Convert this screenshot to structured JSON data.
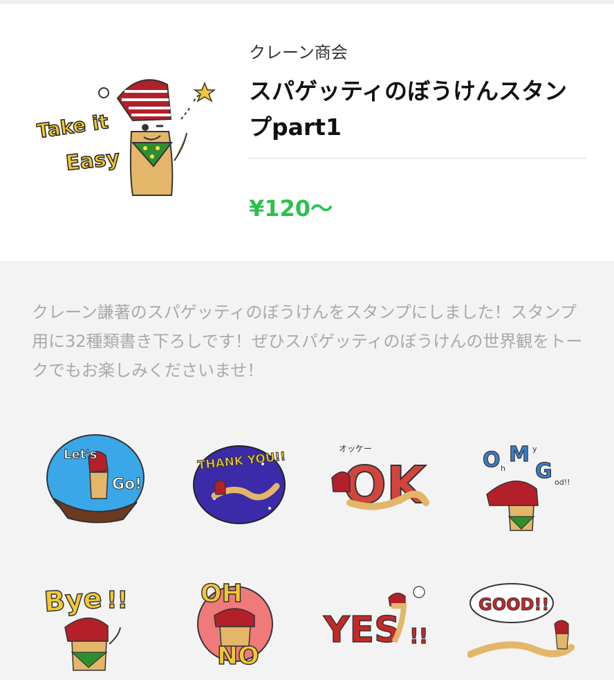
{
  "header": {
    "author": "クレーン商会",
    "title": "スパゲッティのぼうけんスタンプpart1",
    "price": "¥120～",
    "main_sticker": {
      "lettering": [
        "Take it",
        "Easy"
      ]
    }
  },
  "description": "クレーン謙著のスパゲッティのぼうけんをスタンプにしました！スタンプ用に32種類書き下ろしです！ぜひスパゲッティのぼうけんの世界観をトークでもお楽しみくださいませ！",
  "stickers": [
    {
      "lettering": [
        "Let's",
        "Go!"
      ]
    },
    {
      "lettering": [
        "THANK YOU!!"
      ]
    },
    {
      "lettering": [
        "オッケー",
        "OK"
      ]
    },
    {
      "lettering": [
        "O",
        "h",
        "M",
        "y",
        "G",
        "od!!"
      ]
    },
    {
      "lettering": [
        "Bye",
        "!!"
      ]
    },
    {
      "lettering": [
        "OH",
        "NO"
      ]
    },
    {
      "lettering": [
        "YES",
        "!!"
      ]
    },
    {
      "lettering": [
        "GOOD!!"
      ]
    }
  ],
  "colors": {
    "price_green": "#2dc04e",
    "hat_red": "#b3202a",
    "noodle": "#e3b66a",
    "bandana_green": "#2f8f2f"
  }
}
